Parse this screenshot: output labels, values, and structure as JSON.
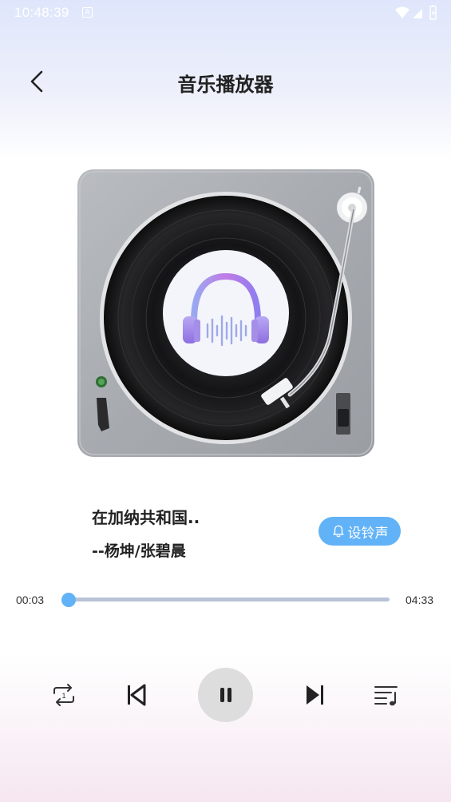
{
  "status_bar": {
    "time": "10:48:39",
    "notification_icon": "a-notification-icon",
    "wifi_icon": "wifi-icon",
    "signal_icon": "signal-icon",
    "battery_icon": "battery-icon"
  },
  "header": {
    "back_icon": "chevron-left-icon",
    "title": "音乐播放器"
  },
  "player": {
    "artwork": "turntable-with-headphones-logo",
    "song_title": "在加纳共和国..",
    "artist": "--杨坤/张碧晨",
    "ringtone_label": "设铃声",
    "ringtone_icon": "bell-icon"
  },
  "progress": {
    "current_time": "00:03",
    "total_time": "04:33",
    "fraction": 0.011
  },
  "controls": {
    "repeat_icon": "repeat-one-icon",
    "prev_icon": "skip-previous-icon",
    "play_state_icon": "pause-icon",
    "next_icon": "skip-next-icon",
    "playlist_icon": "playlist-icon"
  },
  "colors": {
    "accent": "#62b2f7",
    "track": "#b7c3d6",
    "play_button_bg": "#dddddd"
  }
}
